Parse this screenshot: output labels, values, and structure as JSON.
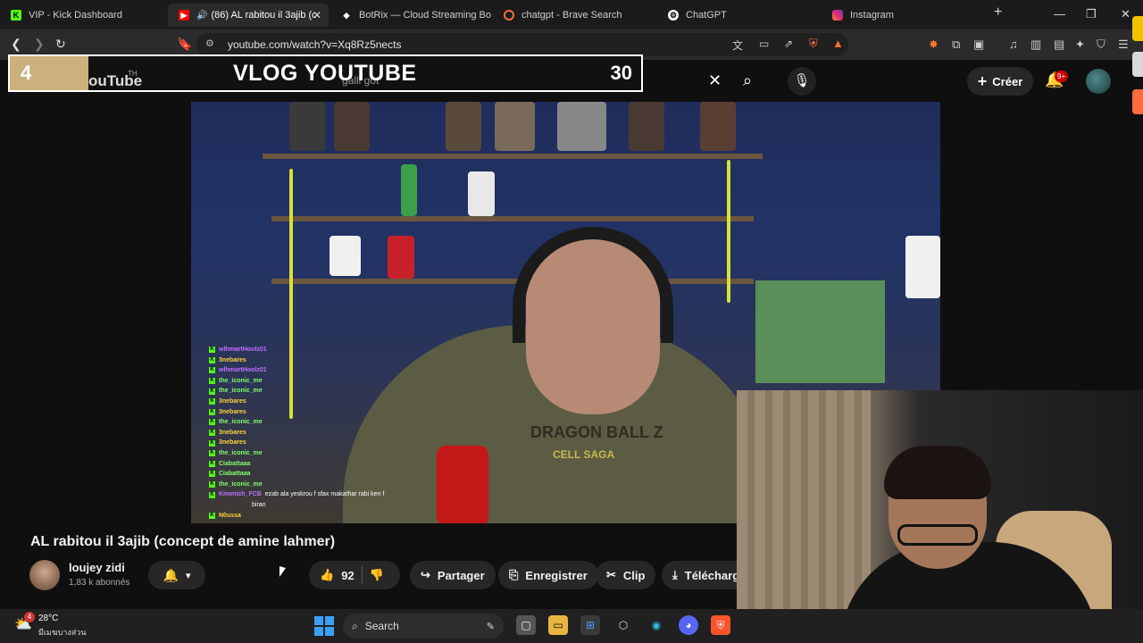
{
  "browser": {
    "tabs": [
      {
        "label": "VIP - Kick Dashboard",
        "icon": "kick-icon"
      },
      {
        "label": "(86) AL rabitou il 3ajib (c",
        "icon": "youtube-icon",
        "active": true
      },
      {
        "label": "BotRix — Cloud Streaming Bot f",
        "icon": "botrix-icon"
      },
      {
        "label": "chatgpt - Brave Search",
        "icon": "brave-search-icon"
      },
      {
        "label": "ChatGPT",
        "icon": "chatgpt-icon"
      },
      {
        "label": "Instagram",
        "icon": "instagram-icon"
      }
    ],
    "new_tab": "+",
    "url": "youtube.com/watch?v=Xq8Rz5nects",
    "extension_badge": "9+"
  },
  "overlay": {
    "count_left": "4",
    "logo_text": "ouTube",
    "logo_sup": "TH",
    "title": "VLOG YOUTUBE",
    "ghost_search": "galli got",
    "count_right": "30"
  },
  "youtube": {
    "create_label": "Créer",
    "notifications": "9+"
  },
  "video": {
    "hoodie_text": "DRAGON BALL Z",
    "hoodie_sub": "CELL SAGA",
    "chat": [
      {
        "user": "wlhmartHoolz01",
        "color": "purple",
        "msg": ""
      },
      {
        "user": "3nebares",
        "color": "yellow",
        "msg": ""
      },
      {
        "user": "wlhmartHoolz01",
        "color": "purple",
        "msg": ""
      },
      {
        "user": "the_iconic_me",
        "color": "green",
        "msg": ""
      },
      {
        "user": "the_iconic_me",
        "color": "green",
        "msg": ""
      },
      {
        "user": "3nebares",
        "color": "yellow",
        "msg": ""
      },
      {
        "user": "3nebares",
        "color": "yellow",
        "msg": ""
      },
      {
        "user": "the_iconic_me",
        "color": "green",
        "msg": ""
      },
      {
        "user": "3nebares",
        "color": "yellow",
        "msg": ""
      },
      {
        "user": "3nebares",
        "color": "yellow",
        "msg": ""
      },
      {
        "user": "the_iconic_me",
        "color": "green",
        "msg": ""
      },
      {
        "user": "Ciabattaaa",
        "color": "green",
        "msg": ""
      },
      {
        "user": "Ciabattaaa",
        "color": "green",
        "msg": ""
      },
      {
        "user": "the_iconic_me",
        "color": "green",
        "msg": ""
      },
      {
        "user": "Kimmich_FCB",
        "color": "purple",
        "msg": "ezab ala yeskrou f sfax makathar rabi ken f"
      },
      {
        "user": "",
        "color": "green",
        "msg": "biran"
      },
      {
        "user": "N0ussa",
        "color": "yellow",
        "msg": ""
      }
    ]
  },
  "info": {
    "title": "AL rabitou il 3ajib (concept de amine lahmer)",
    "channel": "loujey zidi",
    "subscribers": "1,83 k abonnés",
    "likes": "92",
    "share": "Partager",
    "save": "Enregistrer",
    "clip": "Clip",
    "download": "Télécharg"
  },
  "taskbar": {
    "weather_badge": "4",
    "temperature": "28°C",
    "condition": "มีเมฆบางส่วน",
    "search": "Search"
  },
  "colors": {
    "kick_green": "#53fc18",
    "youtube_red": "#ff0000",
    "overlay_gold": "#cbb27c"
  }
}
